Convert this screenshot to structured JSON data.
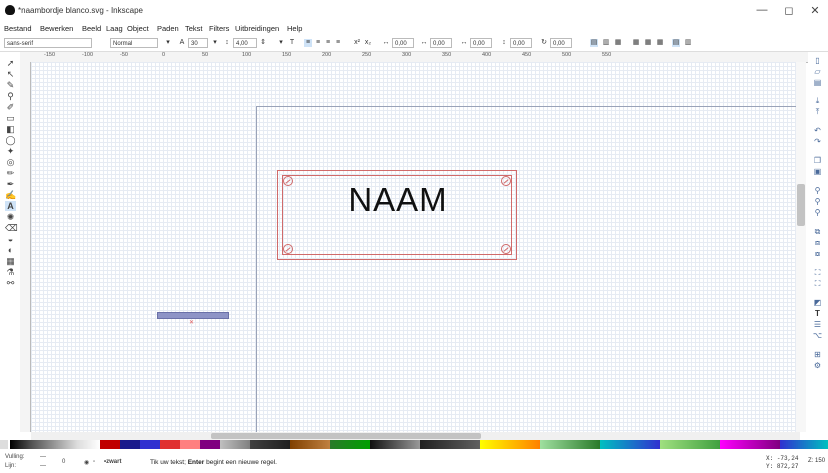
{
  "window": {
    "title": "*naambordje blanco.svg - Inkscape",
    "minimize": "—",
    "maximize": "◻",
    "close": "✕"
  },
  "menu": [
    "Bestand",
    "Bewerken",
    "Beeld",
    "Laag",
    "Object",
    "Paden",
    "Tekst",
    "Filters",
    "Uitbreidingen",
    "Help"
  ],
  "text_toolbar": {
    "font_family": "sans-serif",
    "font_style": "Normal",
    "font_size": "30",
    "line_spacing": "4,00",
    "letter_spacing": "0,00",
    "word_spacing": "0,00",
    "kerning": "0,00",
    "vertical_shift": "0,00",
    "rotation": "0,00"
  },
  "ruler": {
    "labels": [
      "-150",
      "-100",
      "-50",
      "0",
      "50",
      "100",
      "150",
      "200",
      "250",
      "300",
      "350",
      "400",
      "450",
      "500",
      "550"
    ]
  },
  "tools": [
    "selector-tool",
    "node-tool",
    "tweak-tool",
    "zoom-tool",
    "measure-tool",
    "rect-tool",
    "3dbox-tool",
    "ellipse-tool",
    "star-tool",
    "spiral-tool",
    "pencil-tool",
    "pen-tool",
    "calligraphy-tool",
    "text-tool",
    "spray-tool",
    "eraser-tool",
    "bucket-tool",
    "gradient-tool",
    "mesh-tool",
    "dropper-tool",
    "connector-tool"
  ],
  "canvas": {
    "nameplate_text": "NAAM"
  },
  "commands": [
    "new",
    "open",
    "print",
    "import",
    "export",
    "undo",
    "redo",
    "copy",
    "paste",
    "zoom-selection",
    "zoom-drawing",
    "zoom-page",
    "duplicate",
    "clone",
    "unlink",
    "group",
    "ungroup",
    "fill-stroke",
    "text-font",
    "layers",
    "xml-editor",
    "align",
    "preferences"
  ],
  "palette": [
    "#111111",
    "#ffffff",
    "#c00000",
    "#e03030",
    "#ff8080",
    "#1a1a8c",
    "#3030d0",
    "#2a7a2a",
    "#00a000",
    "#ffff00",
    "#ff8000",
    "#800080",
    "#c0c0c0",
    "#808080",
    "#404040",
    "#00c0c0",
    "#804000",
    "#ff00ff",
    "#a0e0a0",
    "#202020"
  ],
  "status": {
    "fill_label": "Vulling:",
    "stroke_label": "Lijn:",
    "fill_value": "—",
    "stroke_value": "—",
    "opacity": "0",
    "layer": "•zwart",
    "message_prefix": "Tik uw tekst;",
    "message_key": "Enter",
    "message_suffix": "begint een nieuwe regel.",
    "x_label": "X:",
    "x_value": "-73,24",
    "y_label": "Y:",
    "y_value": "872,27",
    "zoom_label": "Z:",
    "zoom_value": "150"
  }
}
